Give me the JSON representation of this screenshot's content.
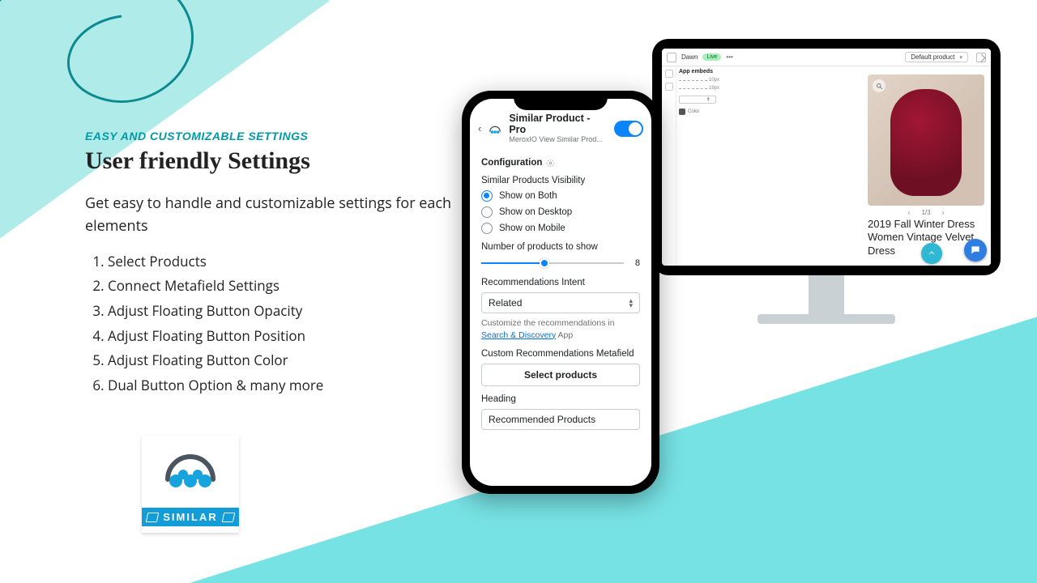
{
  "marketing": {
    "eyebrow": "EASY AND CUSTOMIZABLE SETTINGS",
    "headline": "User friendly Settings",
    "subtext": "Get easy to handle and customizable settings for each elements",
    "list": [
      "Select Products",
      "Connect Metafield Settings",
      "Adjust Floating Button Opacity",
      "Adjust Floating Button Position",
      "Adjust Floating Button Color",
      "Dual Button Option & many more"
    ]
  },
  "logo_badge": "SIMILAR",
  "shopify": {
    "theme_name": "Dawn",
    "status": "Live",
    "template_selector": "Default product",
    "panel_title": "App embeds",
    "px1": "10px",
    "px2": "19px",
    "color_label": "Color",
    "product": {
      "pager": "1/3",
      "title": "2019 Fall Winter Dress Women Vintage Velvet Dress"
    }
  },
  "app": {
    "title": "Similar Product - Pro",
    "subtitle": "MeroxIO View Similar Prod...",
    "config_label": "Configuration",
    "visibility_label": "Similar Products Visibility",
    "visibility_options": [
      "Show on Both",
      "Show on Desktop",
      "Show on Mobile"
    ],
    "num_label": "Number of products to show",
    "num_value": "8",
    "intent_label": "Recommendations Intent",
    "intent_value": "Related",
    "hint_pre": "Customize the recommendations in ",
    "hint_link": "Search & Discovery",
    "hint_post": " App",
    "metafield_label": "Custom Recommendations Metafield",
    "select_products_btn": "Select products",
    "heading_label": "Heading",
    "heading_value": "Recommended Products"
  }
}
